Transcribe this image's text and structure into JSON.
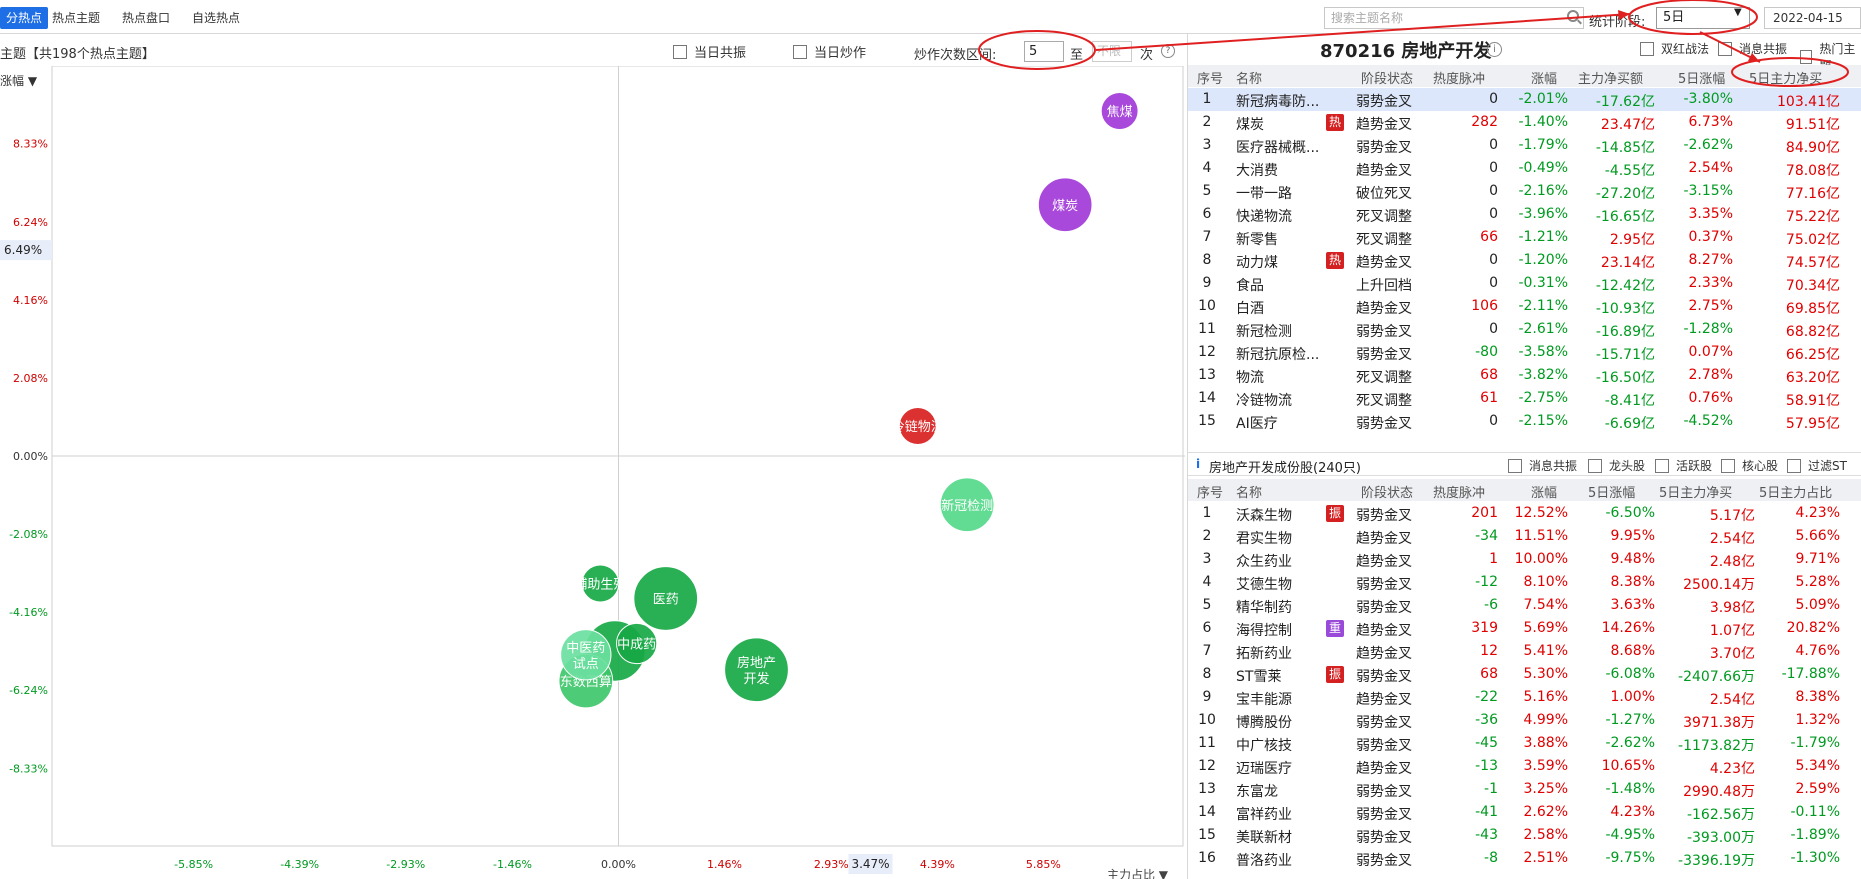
{
  "topbar": {
    "tabs": [
      "分热点",
      "热点主题",
      "热点盘口",
      "自选热点"
    ],
    "active_tab": 0,
    "search_placeholder": "搜索主题名称",
    "period_label": "统计阶段:",
    "period_value": "5日",
    "date": "2022-04-15"
  },
  "subbar": {
    "title": "主题【共198个热点主题】",
    "sort_label": "涨幅",
    "cb_resonance": "当日共振",
    "cb_speculate": "当日炒作",
    "range_label": "炒作次数区间:",
    "range_from": "5",
    "range_sep": "至",
    "range_to_placeholder": "不限",
    "range_unit": "次"
  },
  "chart_data": {
    "type": "scatter",
    "xlabel": "主力占比",
    "ylabel": "涨幅",
    "xlim": [
      -7.8,
      7.8
    ],
    "ylim": [
      -10.4,
      10.4
    ],
    "x_ticks": [
      "-5.85%",
      "-4.39%",
      "-2.93%",
      "-1.46%",
      "0.00%",
      "1.46%",
      "2.93%",
      "4.39%",
      "5.85%"
    ],
    "x_tick_vals": [
      -5.85,
      -4.39,
      -2.93,
      -1.46,
      0,
      1.46,
      2.93,
      4.39,
      5.85
    ],
    "y_ticks": [
      "8.33%",
      "6.24%",
      "4.16%",
      "2.08%",
      "0.00%",
      "-2.08%",
      "-4.16%",
      "-6.24%",
      "-8.33%"
    ],
    "y_tick_vals": [
      8.33,
      6.24,
      4.16,
      2.08,
      0,
      -2.08,
      -4.16,
      -6.24,
      -8.33
    ],
    "x_marker": "3.47%",
    "x_marker_val": 3.47,
    "y_marker": "6.49%",
    "y_marker_val": 5.49,
    "points": [
      {
        "label": "焦煤",
        "x": 6.9,
        "y": 9.2,
        "r": 1.1,
        "color": "#a23ad8"
      },
      {
        "label": "煤炭",
        "x": 6.15,
        "y": 6.7,
        "r": 1.6,
        "color": "#a23ad8"
      },
      {
        "label": "冷链物流",
        "x": 4.12,
        "y": 0.8,
        "r": 1.1,
        "color": "#d92020"
      },
      {
        "label": "新冠检测",
        "x": 4.8,
        "y": -1.3,
        "r": 1.6,
        "color": "#55d98a"
      },
      {
        "label": "辅助生殖",
        "x": -0.25,
        "y": -3.4,
        "r": 1.1,
        "color": "#17a845"
      },
      {
        "label": "医药",
        "x": 0.65,
        "y": -3.8,
        "r": 1.9,
        "color": "#17a845"
      },
      {
        "label": "",
        "x": -0.05,
        "y": -5.2,
        "r": 1.8,
        "color": "#17a845"
      },
      {
        "label": "中成药",
        "x": 0.25,
        "y": -5.0,
        "r": 1.2,
        "color": "#17a845"
      },
      {
        "label": "东数西算",
        "x": -0.45,
        "y": -6.0,
        "r": 1.6,
        "color": "#3ec76a"
      },
      {
        "label": "中医药试点",
        "x": -0.45,
        "y": -5.3,
        "r": 1.5,
        "color": "#6be0a0"
      },
      {
        "label": "房地产开发",
        "x": 1.9,
        "y": -5.7,
        "r": 1.9,
        "color": "#17a845"
      }
    ]
  },
  "right": {
    "stock_title": "870216 房地产开发",
    "cb_double_red": "双红战法",
    "cb_news": "消息共振",
    "cb_hot": "热门主题",
    "theme_headers": [
      "序号",
      "名称",
      "阶段状态",
      "热度脉冲",
      "涨幅",
      "主力净买额",
      "5日涨幅",
      "5日主力净买"
    ],
    "themes": [
      {
        "no": "1",
        "name": "新冠病毒防...",
        "badge": "",
        "stage": "弱势金叉",
        "heat": "0",
        "chg": "-2.01%",
        "net": "-17.62亿",
        "chg5": "-3.80%",
        "net5": "103.41亿"
      },
      {
        "no": "2",
        "name": "煤炭",
        "badge": "热",
        "stage": "趋势金叉",
        "heat": "282",
        "chg": "-1.40%",
        "net": "23.47亿",
        "chg5": "6.73%",
        "net5": "91.51亿"
      },
      {
        "no": "3",
        "name": "医疗器械概...",
        "badge": "",
        "stage": "弱势金叉",
        "heat": "0",
        "chg": "-1.79%",
        "net": "-14.85亿",
        "chg5": "-2.62%",
        "net5": "84.90亿"
      },
      {
        "no": "4",
        "name": "大消费",
        "badge": "",
        "stage": "趋势金叉",
        "heat": "0",
        "chg": "-0.49%",
        "net": "-4.55亿",
        "chg5": "2.54%",
        "net5": "78.08亿"
      },
      {
        "no": "5",
        "name": "一带一路",
        "badge": "",
        "stage": "破位死叉",
        "heat": "0",
        "chg": "-2.16%",
        "net": "-27.20亿",
        "chg5": "-3.15%",
        "net5": "77.16亿"
      },
      {
        "no": "6",
        "name": "快递物流",
        "badge": "",
        "stage": "死叉调整",
        "heat": "0",
        "chg": "-3.96%",
        "net": "-16.65亿",
        "chg5": "3.35%",
        "net5": "75.22亿"
      },
      {
        "no": "7",
        "name": "新零售",
        "badge": "",
        "stage": "死叉调整",
        "heat": "66",
        "chg": "-1.21%",
        "net": "2.95亿",
        "chg5": "0.37%",
        "net5": "75.02亿"
      },
      {
        "no": "8",
        "name": "动力煤",
        "badge": "热",
        "stage": "趋势金叉",
        "heat": "0",
        "chg": "-1.20%",
        "net": "23.14亿",
        "chg5": "8.27%",
        "net5": "74.57亿"
      },
      {
        "no": "9",
        "name": "食品",
        "badge": "",
        "stage": "上升回档",
        "heat": "0",
        "chg": "-0.31%",
        "net": "-12.42亿",
        "chg5": "2.33%",
        "net5": "70.34亿"
      },
      {
        "no": "10",
        "name": "白酒",
        "badge": "",
        "stage": "趋势金叉",
        "heat": "106",
        "chg": "-2.11%",
        "net": "-10.93亿",
        "chg5": "2.75%",
        "net5": "69.85亿"
      },
      {
        "no": "11",
        "name": "新冠检测",
        "badge": "",
        "stage": "弱势金叉",
        "heat": "0",
        "chg": "-2.61%",
        "net": "-16.89亿",
        "chg5": "-1.28%",
        "net5": "68.82亿"
      },
      {
        "no": "12",
        "name": "新冠抗原检...",
        "badge": "",
        "stage": "弱势金叉",
        "heat": "-80",
        "chg": "-3.58%",
        "net": "-15.71亿",
        "chg5": "0.07%",
        "net5": "66.25亿"
      },
      {
        "no": "13",
        "name": "物流",
        "badge": "",
        "stage": "死叉调整",
        "heat": "68",
        "chg": "-3.82%",
        "net": "-16.50亿",
        "chg5": "2.78%",
        "net5": "63.20亿"
      },
      {
        "no": "14",
        "name": "冷链物流",
        "badge": "",
        "stage": "死叉调整",
        "heat": "61",
        "chg": "-2.75%",
        "net": "-8.41亿",
        "chg5": "0.76%",
        "net5": "58.91亿"
      },
      {
        "no": "15",
        "name": "AI医疗",
        "badge": "",
        "stage": "弱势金叉",
        "heat": "0",
        "chg": "-2.15%",
        "net": "-6.69亿",
        "chg5": "-4.52%",
        "net5": "57.95亿"
      }
    ],
    "cons_title": "房地产开发成份股(240只)",
    "cb_msg": "消息共振",
    "cb_leader": "龙头股",
    "cb_active": "活跃股",
    "cb_core": "核心股",
    "cb_st": "过滤ST",
    "cons_headers": [
      "序号",
      "名称",
      "阶段状态",
      "热度脉冲",
      "涨幅",
      "5日涨幅",
      "5日主力净买",
      "5日主力占比"
    ],
    "constituents": [
      {
        "no": "1",
        "name": "沃森生物",
        "badge": "振",
        "bc": "#d42020",
        "stage": "弱势金叉",
        "heat": "201",
        "chg": "12.52%",
        "chg5": "-6.50%",
        "net5": "5.17亿",
        "ratio": "4.23%"
      },
      {
        "no": "2",
        "name": "君实生物",
        "badge": "",
        "bc": "",
        "stage": "趋势金叉",
        "heat": "-34",
        "chg": "11.51%",
        "chg5": "9.95%",
        "net5": "2.54亿",
        "ratio": "5.66%"
      },
      {
        "no": "3",
        "name": "众生药业",
        "badge": "",
        "bc": "",
        "stage": "趋势金叉",
        "heat": "1",
        "chg": "10.00%",
        "chg5": "9.48%",
        "net5": "2.48亿",
        "ratio": "9.71%"
      },
      {
        "no": "4",
        "name": "艾德生物",
        "badge": "",
        "bc": "",
        "stage": "弱势金叉",
        "heat": "-12",
        "chg": "8.10%",
        "chg5": "8.38%",
        "net5": "2500.14万",
        "ratio": "5.28%"
      },
      {
        "no": "5",
        "name": "精华制药",
        "badge": "",
        "bc": "",
        "stage": "弱势金叉",
        "heat": "-6",
        "chg": "7.54%",
        "chg5": "3.63%",
        "net5": "3.98亿",
        "ratio": "5.09%"
      },
      {
        "no": "6",
        "name": "海得控制",
        "badge": "重",
        "bc": "#9a4ad8",
        "stage": "趋势金叉",
        "heat": "319",
        "chg": "5.69%",
        "chg5": "14.26%",
        "net5": "1.07亿",
        "ratio": "20.82%"
      },
      {
        "no": "7",
        "name": "拓新药业",
        "badge": "",
        "bc": "",
        "stage": "趋势金叉",
        "heat": "12",
        "chg": "5.41%",
        "chg5": "8.68%",
        "net5": "3.70亿",
        "ratio": "4.76%"
      },
      {
        "no": "8",
        "name": "ST雪莱",
        "badge": "振",
        "bc": "#d42020",
        "stage": "弱势金叉",
        "heat": "68",
        "chg": "5.30%",
        "chg5": "-6.08%",
        "net5": "-2407.66万",
        "ratio": "-17.88%"
      },
      {
        "no": "9",
        "name": "宝丰能源",
        "badge": "",
        "bc": "",
        "stage": "趋势金叉",
        "heat": "-22",
        "chg": "5.16%",
        "chg5": "1.00%",
        "net5": "2.54亿",
        "ratio": "8.38%"
      },
      {
        "no": "10",
        "name": "博腾股份",
        "badge": "",
        "bc": "",
        "stage": "弱势金叉",
        "heat": "-36",
        "chg": "4.99%",
        "chg5": "-1.27%",
        "net5": "3971.38万",
        "ratio": "1.32%"
      },
      {
        "no": "11",
        "name": "中广核技",
        "badge": "",
        "bc": "",
        "stage": "弱势金叉",
        "heat": "-45",
        "chg": "3.88%",
        "chg5": "-2.62%",
        "net5": "-1173.82万",
        "ratio": "-1.79%"
      },
      {
        "no": "12",
        "name": "迈瑞医疗",
        "badge": "",
        "bc": "",
        "stage": "趋势金叉",
        "heat": "-13",
        "chg": "3.59%",
        "chg5": "10.65%",
        "net5": "4.23亿",
        "ratio": "5.34%"
      },
      {
        "no": "13",
        "name": "东富龙",
        "badge": "",
        "bc": "",
        "stage": "弱势金叉",
        "heat": "-1",
        "chg": "3.25%",
        "chg5": "-1.48%",
        "net5": "2990.48万",
        "ratio": "2.59%"
      },
      {
        "no": "14",
        "name": "富祥药业",
        "badge": "",
        "bc": "",
        "stage": "弱势金叉",
        "heat": "-41",
        "chg": "2.62%",
        "chg5": "4.23%",
        "net5": "-162.56万",
        "ratio": "-0.11%"
      },
      {
        "no": "15",
        "name": "美联新材",
        "badge": "",
        "bc": "",
        "stage": "弱势金叉",
        "heat": "-43",
        "chg": "2.58%",
        "chg5": "-4.95%",
        "net5": "-393.00万",
        "ratio": "-1.89%"
      },
      {
        "no": "16",
        "name": "普洛药业",
        "badge": "",
        "bc": "",
        "stage": "弱势金叉",
        "heat": "-8",
        "chg": "2.51%",
        "chg5": "-9.75%",
        "net5": "-3396.19万",
        "ratio": "-1.30%"
      }
    ]
  }
}
